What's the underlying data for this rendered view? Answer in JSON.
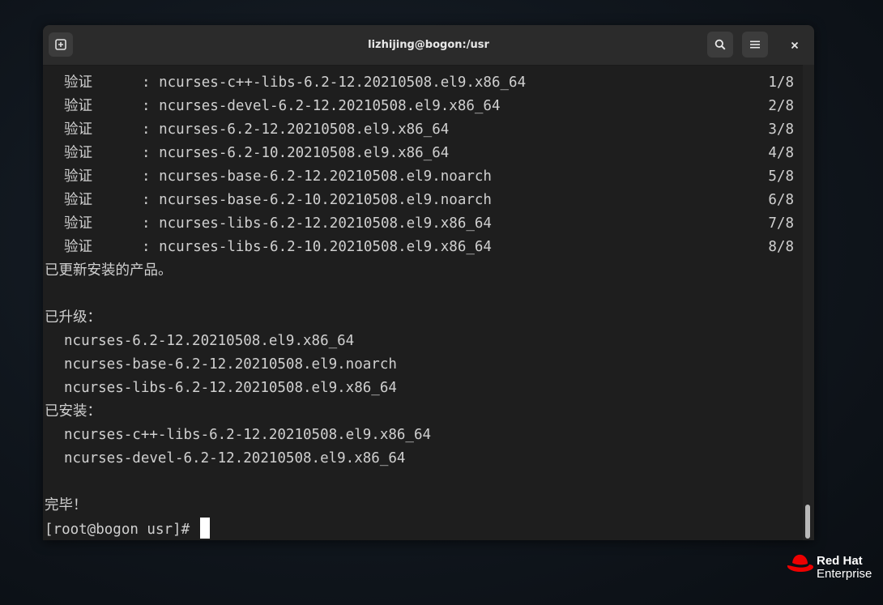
{
  "window": {
    "title": "lizhijing@bogon:/usr"
  },
  "terminal": {
    "verify_lines": [
      {
        "label": "验证",
        "package": ": ncurses-c++-libs-6.2-12.20210508.el9.x86_64",
        "count": "1/8"
      },
      {
        "label": "验证",
        "package": ": ncurses-devel-6.2-12.20210508.el9.x86_64",
        "count": "2/8"
      },
      {
        "label": "验证",
        "package": ": ncurses-6.2-12.20210508.el9.x86_64",
        "count": "3/8"
      },
      {
        "label": "验证",
        "package": ": ncurses-6.2-10.20210508.el9.x86_64",
        "count": "4/8"
      },
      {
        "label": "验证",
        "package": ": ncurses-base-6.2-12.20210508.el9.noarch",
        "count": "5/8"
      },
      {
        "label": "验证",
        "package": ": ncurses-base-6.2-10.20210508.el9.noarch",
        "count": "6/8"
      },
      {
        "label": "验证",
        "package": ": ncurses-libs-6.2-12.20210508.el9.x86_64",
        "count": "7/8"
      },
      {
        "label": "验证",
        "package": ": ncurses-libs-6.2-10.20210508.el9.x86_64",
        "count": "8/8"
      }
    ],
    "installed_msg": "已更新安装的产品。",
    "upgraded_header": "已升级：",
    "upgraded": [
      "ncurses-6.2-12.20210508.el9.x86_64",
      "ncurses-base-6.2-12.20210508.el9.noarch",
      "ncurses-libs-6.2-12.20210508.el9.x86_64"
    ],
    "installed_header": "已安装：",
    "installed": [
      "ncurses-c++-libs-6.2-12.20210508.el9.x86_64",
      "ncurses-devel-6.2-12.20210508.el9.x86_64"
    ],
    "done_msg": "完毕！",
    "prompt": "[root@bogon usr]# "
  },
  "branding": {
    "line1": "Red Hat",
    "line2": "Enterprise"
  },
  "colors": {
    "terminal_bg": "#1e1e1e",
    "titlebar_bg": "#2b2b2b",
    "text": "#d0d0d0",
    "redhat_red": "#ee0000"
  },
  "icons": {
    "new_tab": "new-tab-icon",
    "search": "search-icon",
    "menu": "hamburger-menu-icon",
    "close": "close-icon"
  }
}
